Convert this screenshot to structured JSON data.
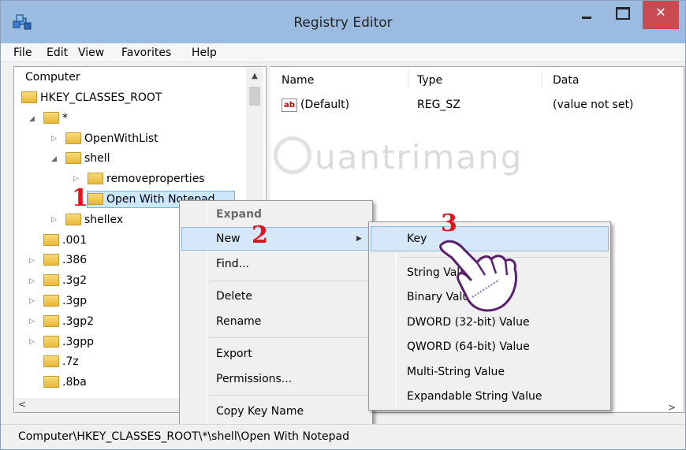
{
  "window": {
    "title": "Registry Editor"
  },
  "titlebar": {
    "close_label": "✕"
  },
  "menu": [
    "File",
    "Edit",
    "View",
    "Favorites",
    "Help"
  ],
  "tree": {
    "root": "Computer",
    "hkcr": "HKEY_CLASSES_ROOT",
    "star": "*",
    "openwithlist": "OpenWithList",
    "shell": "shell",
    "removeproperties": "removeproperties",
    "openwithnotepad": "Open With Notepad",
    "shellex": "shellex",
    "items": [
      ".001",
      ".386",
      ".3g2",
      ".3gp",
      ".3gp2",
      ".3gpp",
      ".7z",
      ".8ba"
    ]
  },
  "list": {
    "columns": [
      "Name",
      "Type",
      "Data"
    ],
    "rows": [
      {
        "name": "(Default)",
        "type": "REG_SZ",
        "data": "(value not set)",
        "icon": "ab"
      }
    ]
  },
  "watermark": "uantrimang",
  "context_menu": {
    "items": [
      "Expand",
      "New",
      "Find...",
      "Delete",
      "Rename",
      "Export",
      "Permissions...",
      "Copy Key Name"
    ]
  },
  "submenu": {
    "items": [
      "Key",
      "String Value",
      "Binary Value",
      "DWORD (32-bit) Value",
      "QWORD (64-bit) Value",
      "Multi-String Value",
      "Expandable String Value"
    ]
  },
  "steps": [
    "1",
    "2",
    "3"
  ],
  "status": {
    "path": "Computer\\HKEY_CLASSES_ROOT\\*\\shell\\Open With Notepad"
  },
  "colors": {
    "titlebar": "#9cbbe0",
    "close": "#c74b50",
    "selection": "#cce8ff",
    "highlight": "#d5e7f8",
    "step_marker": "#e0141e"
  }
}
